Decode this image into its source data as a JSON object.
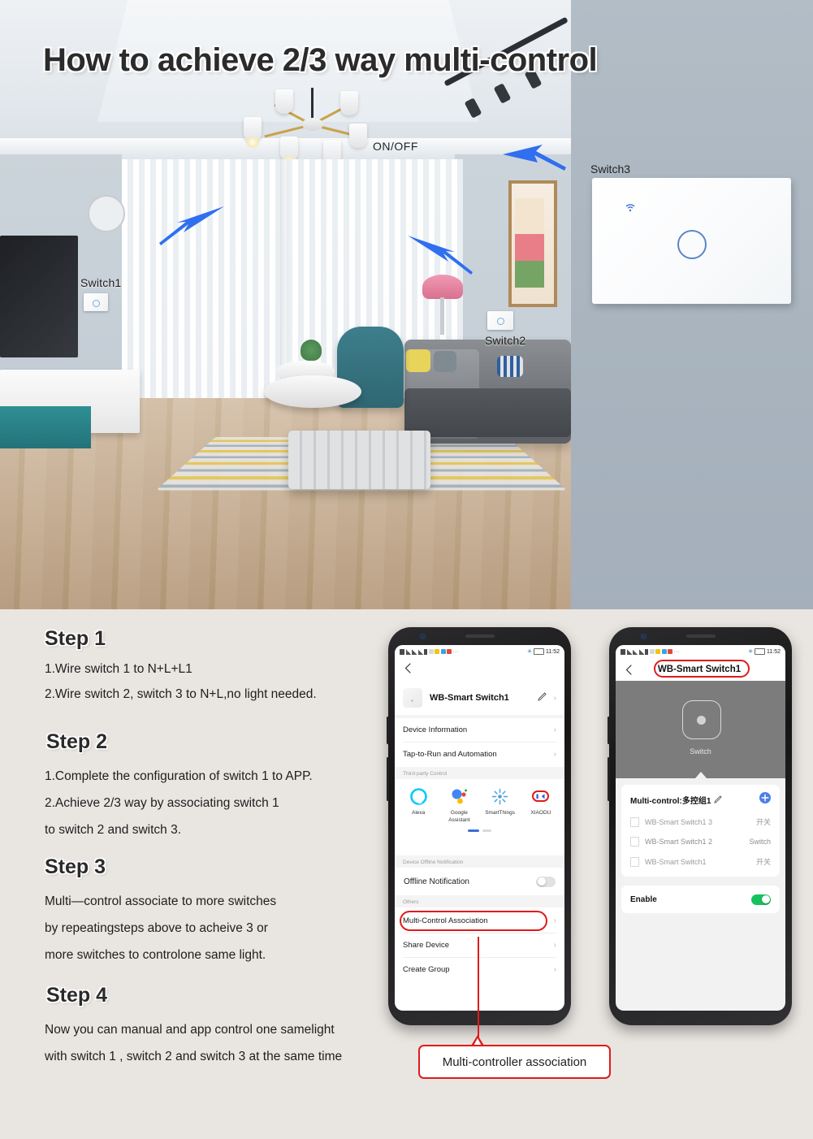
{
  "hero": {
    "title": "How to achieve 2/3 way multi-control",
    "onoff_label": "ON/OFF",
    "switch1_label": "Switch1",
    "switch2_label": "Switch2",
    "switch3_label": "Switch3",
    "accent_arrow_color": "#2f6ff0"
  },
  "steps": [
    {
      "title": "Step 1",
      "lines": [
        "1.Wire switch 1 to N+L+L1",
        "2.Wire switch 2, switch 3 to N+L,no light needed."
      ]
    },
    {
      "title": "Step 2",
      "lines": [
        "1.Complete the configuration of switch 1 to APP.",
        "2.Achieve 2/3 way by associating switch 1",
        "   to switch 2 and switch 3."
      ]
    },
    {
      "title": "Step 3",
      "lines": [
        "Multi—control associate to more switches",
        "by repeatingsteps above to acheive 3 or",
        "more switches to controlone same light."
      ]
    },
    {
      "title": "Step 4",
      "lines": [
        "Now you can manual and app control one samelight",
        "with switch 1 , switch 2 and switch 3 at the same time"
      ]
    }
  ],
  "phone_left": {
    "statusbar": {
      "time": "11:52"
    },
    "back_icon": "chevron-left-icon",
    "device": {
      "name": "WB-Smart Switch1",
      "edit_icon": "pencil-icon",
      "chevron": "›"
    },
    "menu_top": [
      {
        "label": "Device Information",
        "chevron": "›"
      },
      {
        "label": "Tap-to-Run and Automation",
        "chevron": "›"
      }
    ],
    "third_party": {
      "header": "Third-party Control",
      "items": [
        {
          "label": "Alexa",
          "icon": "alexa-icon",
          "color": "#00caff"
        },
        {
          "label": "Google Assistant",
          "icon": "google-assistant-icon",
          "color": "#4285f4"
        },
        {
          "label": "SmartThings",
          "icon": "smartthings-icon",
          "color": "#4aa3df"
        },
        {
          "label": "XIAODU",
          "icon": "xiaodu-icon",
          "color": "#d93025"
        }
      ]
    },
    "offline": {
      "header": "Device Offline Notification",
      "label": "Offline Notification",
      "toggle_on": false
    },
    "others": {
      "header": "Others",
      "items": [
        {
          "label": "Multi-Control Association",
          "chevron": "›",
          "highlighted": true
        },
        {
          "label": "Share Device",
          "chevron": "›",
          "highlighted": false
        },
        {
          "label": "Create Group",
          "chevron": "›",
          "highlighted": false
        }
      ]
    }
  },
  "phone_right": {
    "statusbar": {
      "time": "11:52"
    },
    "back_icon": "chevron-left-icon",
    "title": "WB-Smart Switch1",
    "device_tile_label": "Switch",
    "group": {
      "title": "Multi-control:多控组1",
      "edit_icon": "pencil-icon",
      "add_icon": "plus-circle-icon",
      "rows": [
        {
          "name": "WB-Smart Switch1 3",
          "value": "开关"
        },
        {
          "name": "WB-Smart Switch1 2",
          "value": "Switch"
        },
        {
          "name": "WB-Smart Switch1",
          "value": "开关"
        }
      ]
    },
    "enable": {
      "label": "Enable",
      "toggle_on": true,
      "on_color": "#16c25d"
    }
  },
  "callout": {
    "text": "Multi-controller association",
    "color": "#e01b1b"
  }
}
